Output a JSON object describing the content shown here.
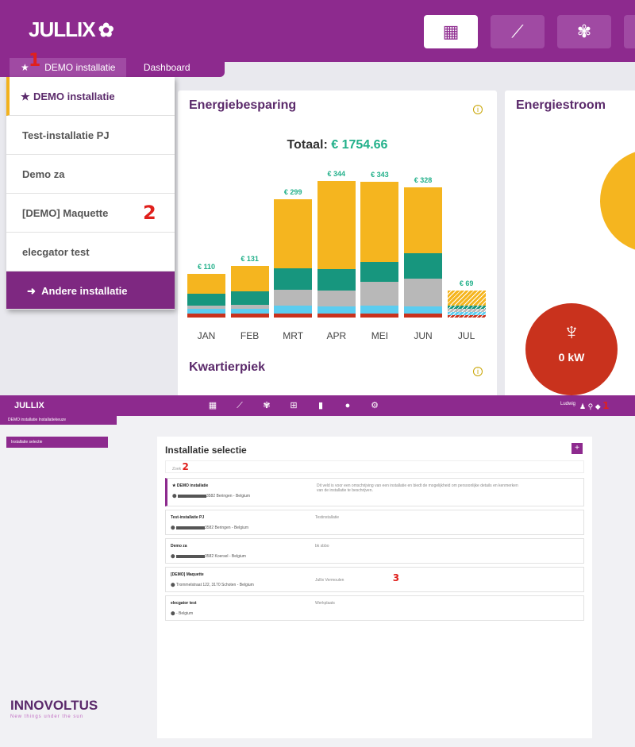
{
  "top": {
    "logo": "JULLIX",
    "nav_icons": [
      "dashboard-icon",
      "chart-icon",
      "brain-icon"
    ],
    "breadcrumb": {
      "installation": "DEMO installatie",
      "page": "Dashboard"
    },
    "marker_1": "1",
    "marker_2": "2",
    "dropdown": {
      "items": [
        {
          "label": "DEMO installatie"
        },
        {
          "label": "Test-installatie PJ"
        },
        {
          "label": "Demo za"
        },
        {
          "label": "[DEMO] Maquette"
        },
        {
          "label": "elecgator test"
        }
      ],
      "other_label": "Andere installatie"
    },
    "energiebesparing": {
      "title": "Energiebesparing",
      "totaal_label": "Totaal:",
      "totaal_value": "€ 1754.66"
    },
    "energiestroom": {
      "title": "Energiestroom",
      "grid_value": "0 kW"
    },
    "kwartierpiek": {
      "title": "Kwartierpiek"
    }
  },
  "chart_data": {
    "type": "bar",
    "title": "Energiebesparing",
    "categories": [
      "JAN",
      "FEB",
      "MRT",
      "APR",
      "MEI",
      "JUN",
      "JUL"
    ],
    "totals": [
      110,
      131,
      299,
      344,
      343,
      328,
      69
    ],
    "total_labels": [
      "€ 110",
      "€ 131",
      "€ 299",
      "€ 344",
      "€ 343",
      "€ 328",
      "€ 69"
    ],
    "series": [
      {
        "color": "#c9321d",
        "values": [
          10,
          10,
          10,
          10,
          10,
          10,
          6
        ]
      },
      {
        "color": "#5bcdf0",
        "values": [
          12,
          12,
          20,
          18,
          20,
          18,
          8
        ]
      },
      {
        "color": "#b8b8b8",
        "values": [
          8,
          10,
          40,
          40,
          60,
          70,
          8
        ]
      },
      {
        "color": "#17967e",
        "values": [
          30,
          34,
          55,
          55,
          50,
          65,
          8
        ]
      },
      {
        "color": "#f5b51f",
        "values": [
          50,
          65,
          174,
          221,
          203,
          165,
          39
        ]
      }
    ],
    "hatched_last": true,
    "grid": false
  },
  "bottom": {
    "logo": "JULLIX",
    "breadcrumb": "DEMO installatie   Installatiekeuze",
    "side_item": "Installatie selectie",
    "user": "Ludwig",
    "title": "Installatie selectie",
    "search_placeholder": "Zoek",
    "marker_1": "1",
    "marker_2": "2",
    "marker_3": "3",
    "brand": "INNOVOLTUS",
    "tagline": "New things under the sun",
    "installations": [
      {
        "name": "DEMO installatie",
        "address": "3582 Beringen - Belgium",
        "desc": "Dit veld is voor een omschrijving van een installatie en biedt de mogelijkheid om persoonlijke details en kenmerken van de installatie te beschrijven."
      },
      {
        "name": "Test-installatie PJ",
        "address": "3582 Beringen - Belgium",
        "desc": "Testinstallatie"
      },
      {
        "name": "Demo za",
        "address": "3582 Koersel - Belgium",
        "desc": "bk sbbo"
      },
      {
        "name": "[DEMO] Maquette",
        "address": "Trommelstraat 122, 3170 Schoten - Belgium",
        "desc": "Jullix Vermoulen"
      },
      {
        "name": "elecgator test",
        "address": "- Belgium",
        "desc": "Werkplaats"
      }
    ]
  }
}
